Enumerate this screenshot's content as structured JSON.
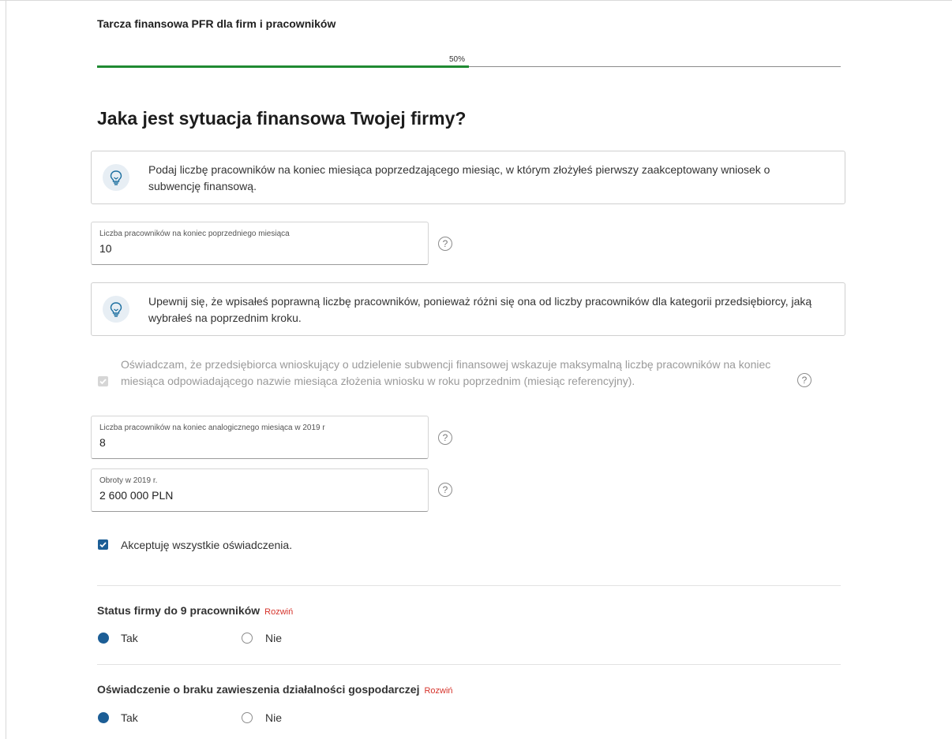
{
  "header": {
    "app_title": "Tarcza finansowa PFR dla firm i pracowników",
    "progress_label": "50%",
    "progress_value": 0.5,
    "accent_color": "#1f8a32"
  },
  "page": {
    "title": "Jaka jest sytuacja finansowa Twojej firmy?"
  },
  "info_1": {
    "icon": "lightbulb-icon",
    "text": "Podaj liczbę pracowników na koniec miesiąca poprzedzającego miesiąc, w którym złożyłeś pierwszy zaakceptowany wniosek o subwencję finansową."
  },
  "field_employees_prev": {
    "label": "Liczba pracowników na koniec poprzedniego miesiąca",
    "value": "10"
  },
  "info_2": {
    "icon": "lightbulb-icon",
    "text": "Upewnij się, że wpisałeś poprawną liczbę pracowników, ponieważ różni się ona od liczby pracowników dla kategorii przedsiębiorcy, jaką wybrałeś na poprzednim kroku."
  },
  "declaration": {
    "checked": true,
    "disabled": true,
    "text": "Oświadczam, że przedsiębiorca wnioskujący o udzielenie subwencji finansowej wskazuje maksymalną liczbę pracowników na koniec miesiąca odpowiadającego nazwie miesiąca złożenia wniosku w roku poprzednim (miesiąc referencyjny)."
  },
  "field_employees_2019": {
    "label": "Liczba pracowników na koniec analogicznego miesiąca w 2019 r",
    "value": "8"
  },
  "field_turnover_2019": {
    "label": "Obroty w 2019 r.",
    "value": "2 600 000 PLN"
  },
  "accept_all": {
    "checked": true,
    "label": "Akceptuję wszystkie oświadczenia."
  },
  "help_glyph": "?",
  "sections": [
    {
      "title": "Status firmy do 9 pracowników",
      "expand_label": "Rozwiń",
      "options": [
        {
          "label": "Tak",
          "selected": true
        },
        {
          "label": "Nie",
          "selected": false
        }
      ]
    },
    {
      "title": "Oświadczenie o braku zawieszenia działalności gospodarczej",
      "expand_label": "Rozwiń",
      "options": [
        {
          "label": "Tak",
          "selected": true
        },
        {
          "label": "Nie",
          "selected": false
        }
      ]
    }
  ],
  "colors": {
    "primary": "#1c5e96",
    "link": "#d6332b",
    "progress": "#1f8a32"
  }
}
